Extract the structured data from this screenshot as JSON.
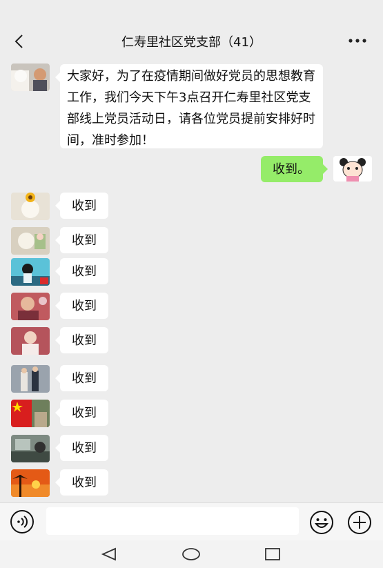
{
  "header": {
    "title": "仁寿里社区党支部（41）",
    "back_icon": "back-arrow-icon",
    "more_icon": "more-dots-icon"
  },
  "messages": {
    "notice": "大家好，为了在疫情期间做好党员的思想教育工作，我们今天下午3点召开仁寿里社区党支部线上党员活动日，请各位党员提前安排好时间，准时参加！",
    "my_reply": "收到。",
    "replies": [
      "收到",
      "收到",
      "收到",
      "收到",
      "收到",
      "收到",
      "收到",
      "收到",
      "收到"
    ]
  },
  "input_bar": {
    "placeholder": "",
    "voice_icon": "voice-icon",
    "emoji_icon": "emoji-icon",
    "plus_icon": "plus-circle-icon"
  },
  "navbar": {
    "icons": [
      "back-triangle-icon",
      "home-circle-icon",
      "recent-square-icon"
    ]
  },
  "colors": {
    "background": "#ededed",
    "my_bubble": "#95ec69",
    "other_bubble": "#ffffff"
  }
}
